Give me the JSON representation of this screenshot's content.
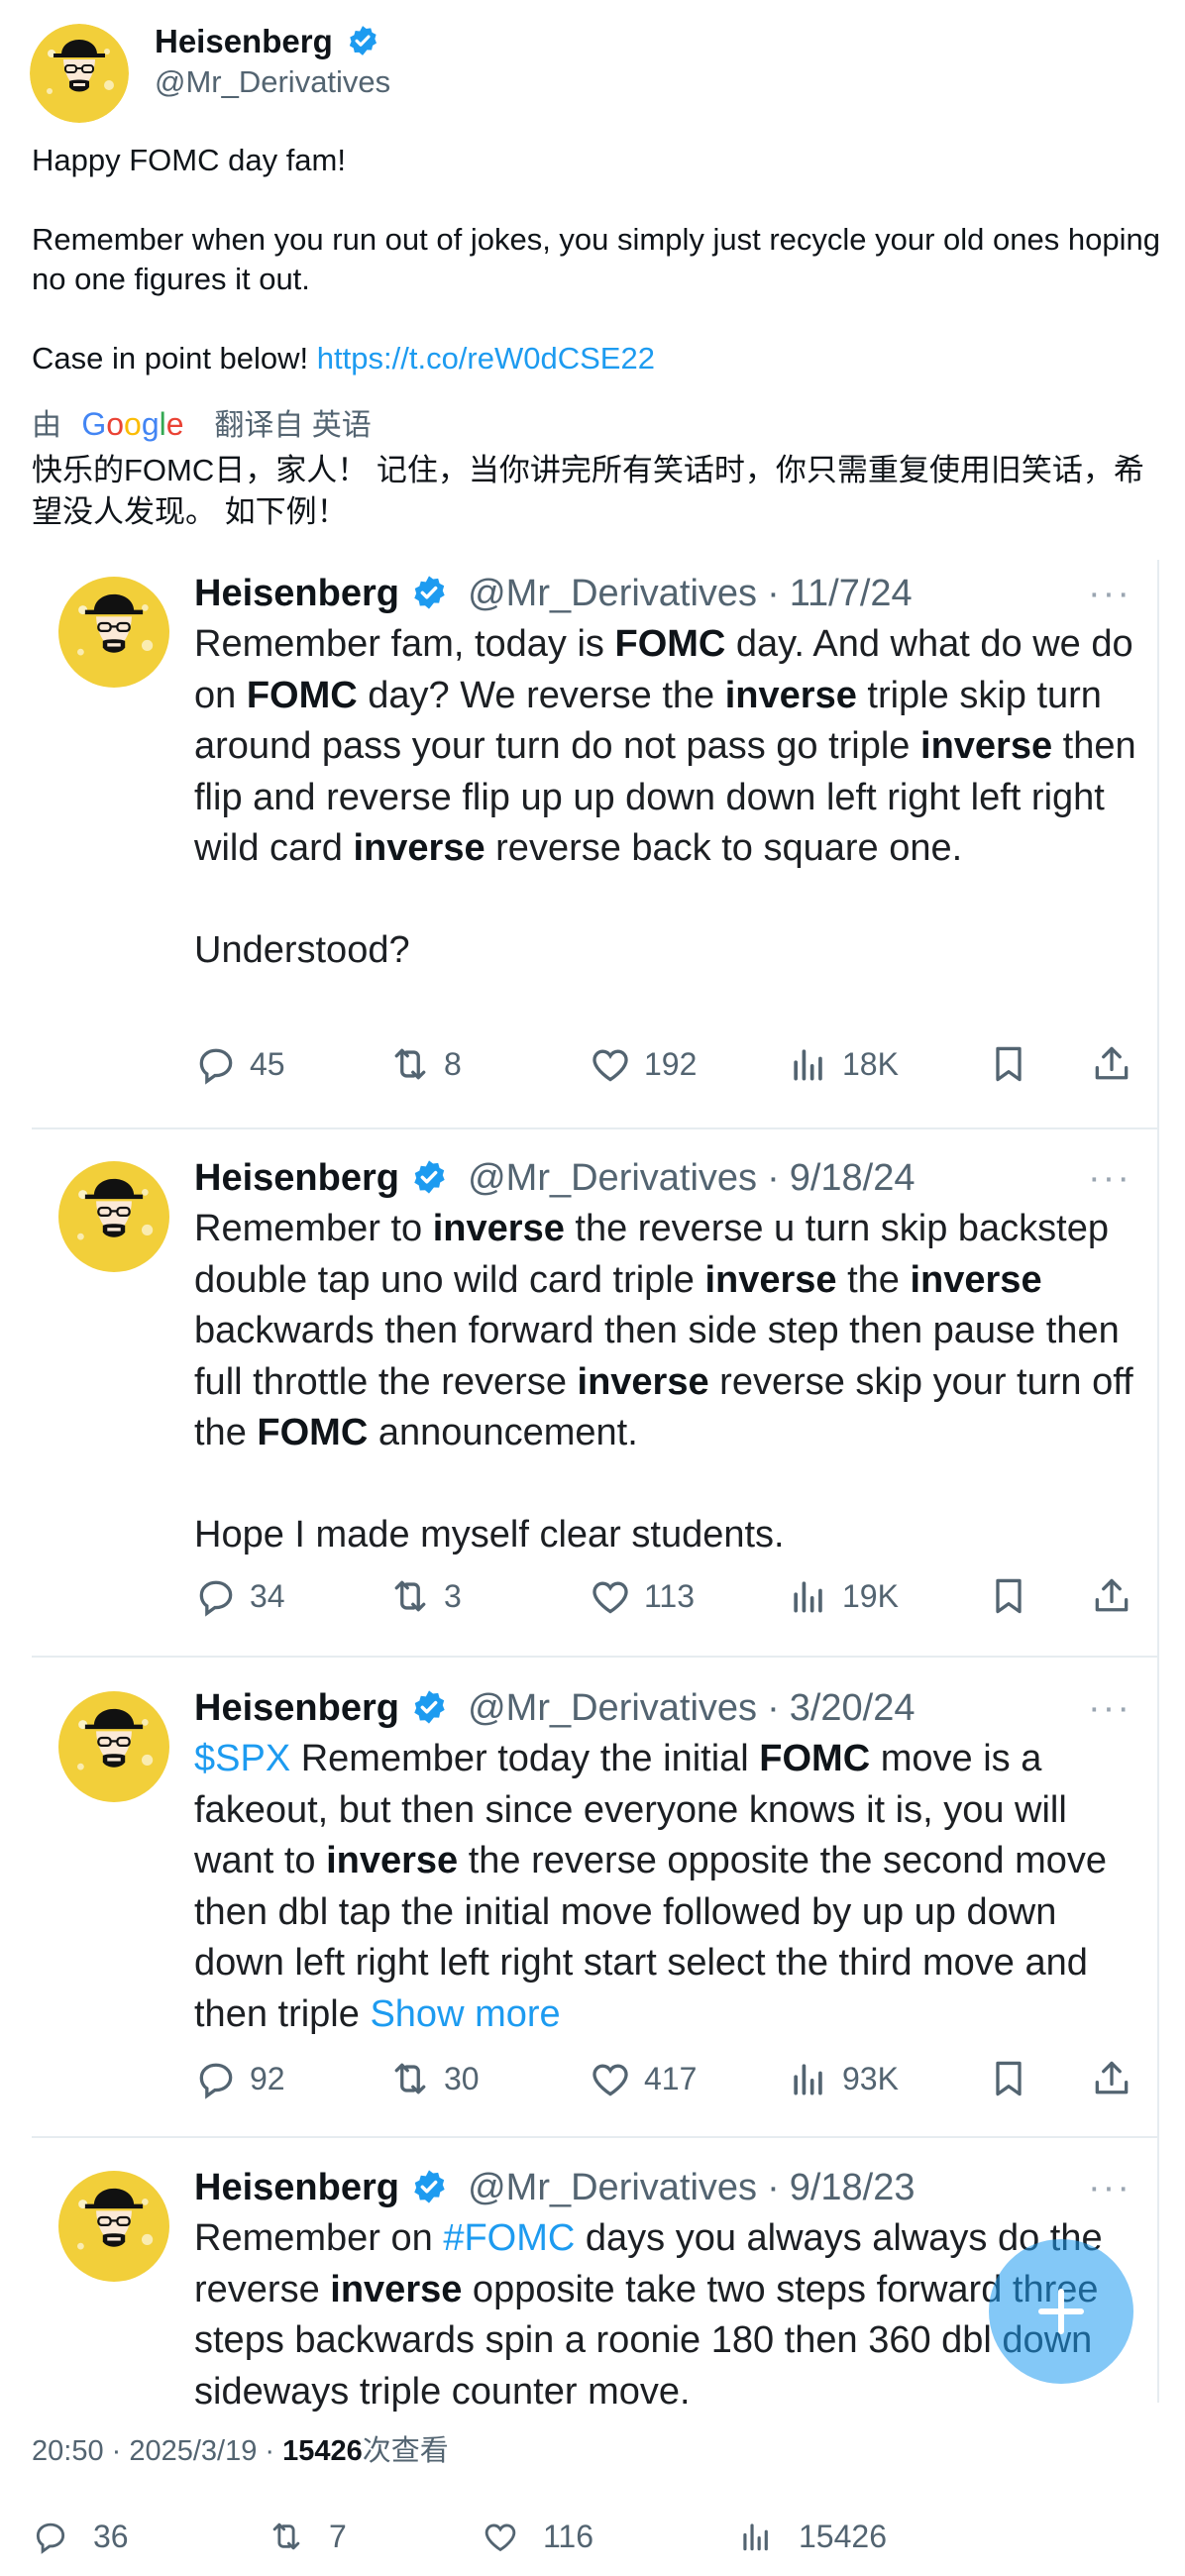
{
  "author": {
    "name": "Heisenberg",
    "handle": "@Mr_Derivatives"
  },
  "tweet": {
    "line1": "Happy FOMC day fam!",
    "line2": "Remember when you run out of jokes, you simply just recycle your old ones hoping no one figures it out.",
    "line3_prefix": "Case in point below!",
    "link": "https://t.co/reW0dCSE22"
  },
  "translation": {
    "by": "由",
    "google": "Google",
    "translated_from": "翻译自 英语",
    "text": "快乐的FOMC日，家人！ 记住，当你讲完所有笑话时，你只需重复使用旧笑话，希望没人发现。 如下例！"
  },
  "quoted": [
    {
      "name": "Heisenberg",
      "handle": "@Mr_Derivatives",
      "date": "11/7/24",
      "last_line": "Understood?",
      "replies": "45",
      "retweets": "8",
      "likes": "192",
      "views": "18K"
    },
    {
      "name": "Heisenberg",
      "handle": "@Mr_Derivatives",
      "date": "9/18/24",
      "last_line": "Hope I made myself clear students.",
      "replies": "34",
      "retweets": "3",
      "likes": "113",
      "views": "19K"
    },
    {
      "name": "Heisenberg",
      "handle": "@Mr_Derivatives",
      "date": "3/20/24",
      "cashtag": "$SPX",
      "show_more": "Show more",
      "replies": "92",
      "retweets": "30",
      "likes": "417",
      "views": "93K"
    },
    {
      "name": "Heisenberg",
      "handle": "@Mr_Derivatives",
      "date": "9/18/23",
      "hashtag": "#FOMC"
    }
  ],
  "meta": {
    "time": "20:50 · 2025/3/19 · ",
    "views": "15426",
    "views_label": "次查看"
  },
  "stats": {
    "replies": "36",
    "retweets": "7",
    "likes": "116",
    "views": "15426"
  },
  "colors": {
    "accent": "#1d9bf0",
    "text": "#0f1419",
    "secondary": "#536471"
  }
}
